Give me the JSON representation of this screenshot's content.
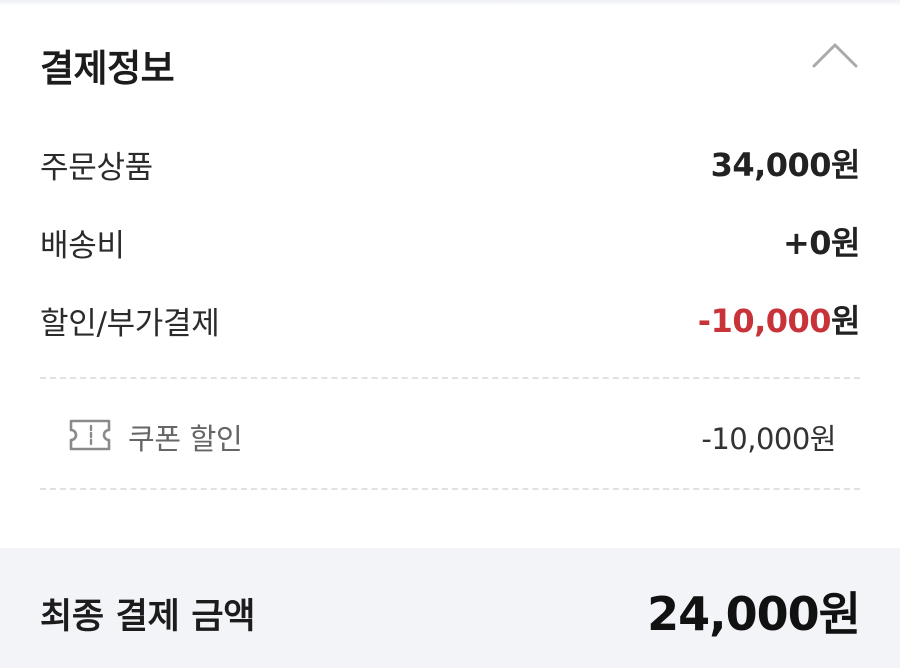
{
  "header": {
    "title": "결제정보",
    "collapse_icon": "chevron-up-icon"
  },
  "summary": {
    "items": [
      {
        "label": "주문상품",
        "amount": "34,000",
        "unit": "원"
      },
      {
        "label": "배송비",
        "amount": "+0",
        "unit": "원"
      },
      {
        "label": "할인/부가결제",
        "amount": "-10,000",
        "unit": "원",
        "amount_color": "#c8333a"
      }
    ]
  },
  "discount_detail": {
    "icon": "coupon-ticket-icon",
    "label": "쿠폰 할인",
    "value": "-10,000원"
  },
  "total": {
    "label": "최종 결제 금액",
    "value": "24,000원"
  },
  "colors": {
    "discount_red": "#c8333a",
    "footer_bg": "#f2f4f8",
    "divider": "#e1e1e1"
  }
}
